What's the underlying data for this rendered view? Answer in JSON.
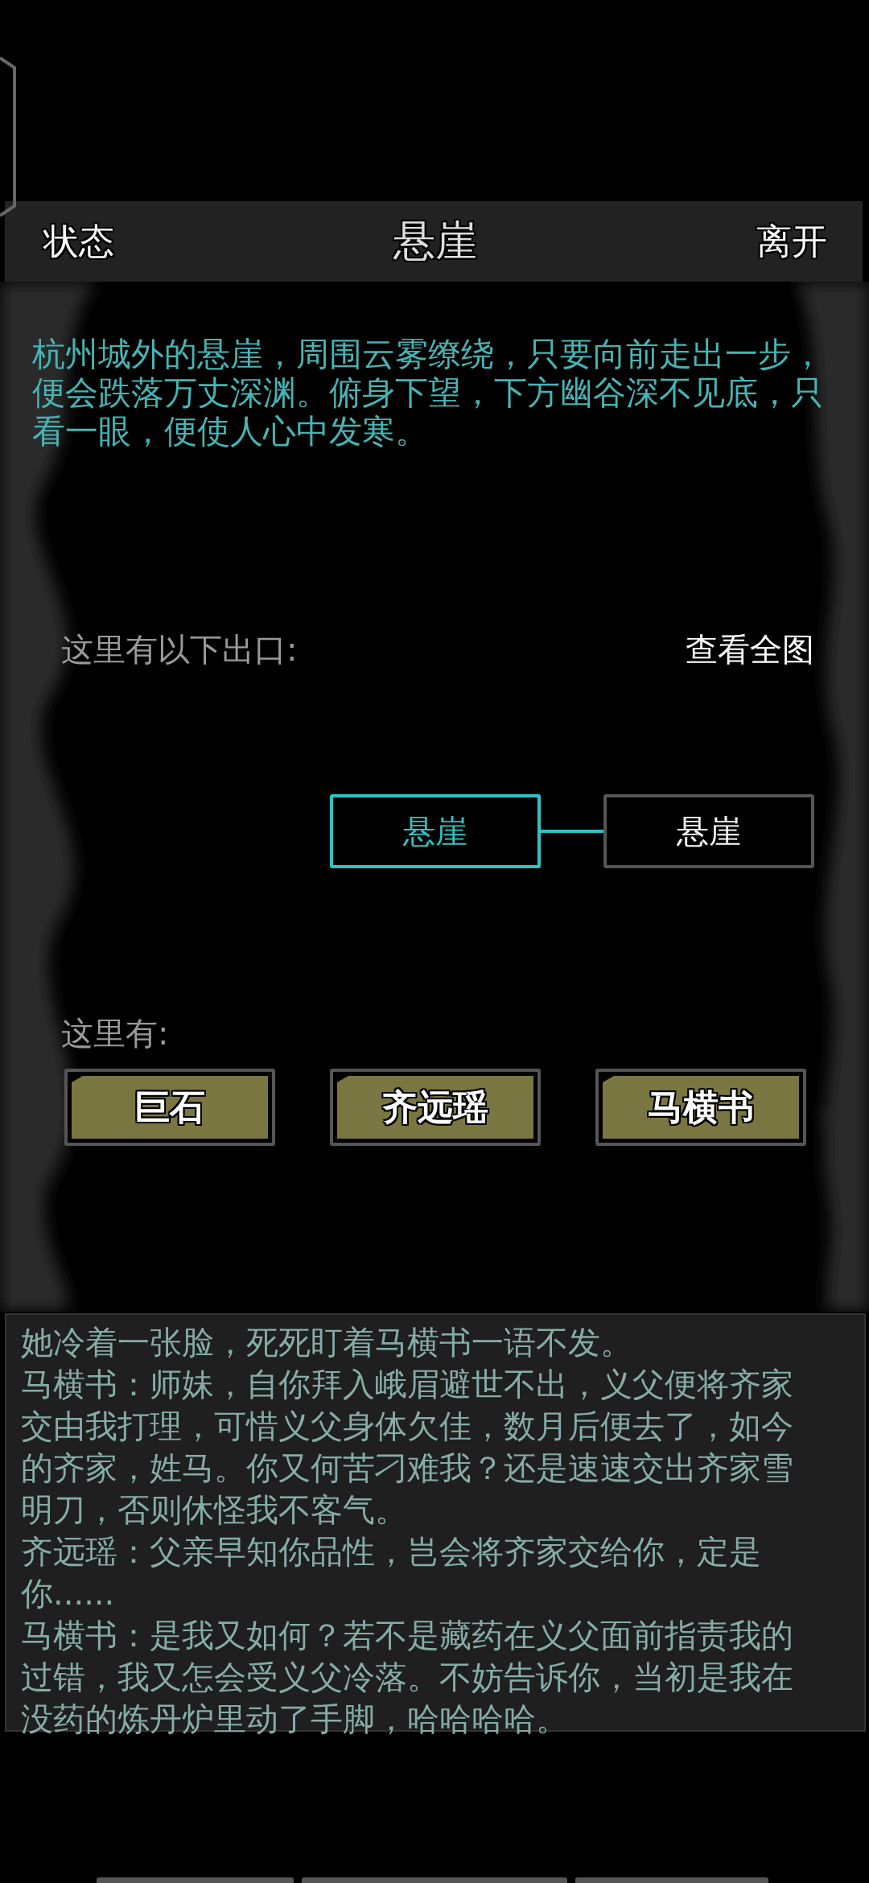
{
  "header": {
    "left": "状态",
    "title": "悬崖",
    "right": "离开"
  },
  "description": "杭州城外的悬崖，周围云雾缭绕，只要向前走出一步，便会跌落万丈深渊。俯身下望，下方幽谷深不见底，只看一眼，便使人心中发寒。",
  "exits": {
    "label": "这里有以下出口:",
    "map_link": "查看全图",
    "nodes": [
      {
        "label": "悬崖",
        "selected": true
      },
      {
        "label": "悬崖",
        "selected": false
      }
    ]
  },
  "here": {
    "label": "这里有:",
    "items": [
      "巨石",
      "齐远瑶",
      "马横书"
    ]
  },
  "log": [
    "她冷着一张脸，死死盯着马横书一语不发。",
    "马横书：师妹，自你拜入峨眉避世不出，义父便将齐家交由我打理，可惜义父身体欠佳，数月后便去了，如今的齐家，姓马。你又何苦刁难我？还是速速交出齐家雪明刀，否则休怪我不客气。",
    "齐远瑶：父亲早知你品性，岂会将齐家交给你，定是你......",
    "马横书：是我又如何？若不是藏药在义父面前指责我的过错，我又怎会受义父冷落。不妨告诉你，当初是我在没药的炼丹炉里动了手脚，哈哈哈哈。"
  ]
}
